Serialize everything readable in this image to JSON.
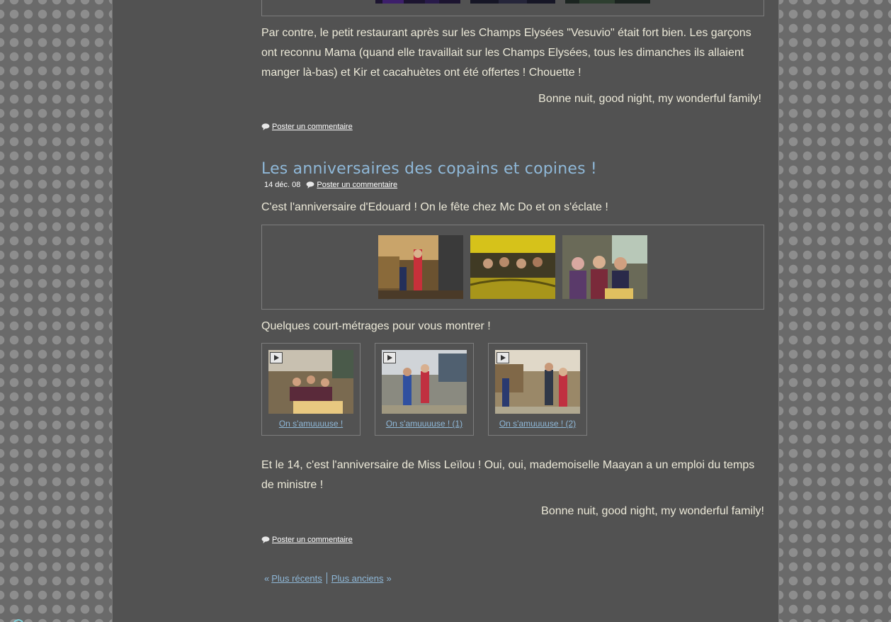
{
  "post_previous": {
    "paragraph": "Par contre, le petit restaurant après sur les Champs Elysées \"Vesuvio\" était fort bien. Les garçons ont reconnu Mama (quand elle travaillait sur les Champs Elysées, tous les dimanches ils allaient manger là-bas) et Kir et cacahuètes ont été offertes ! Chouette !",
    "signoff": "Bonne nuit, good night, my wonderful family!",
    "comment_link": "Poster un commentaire"
  },
  "post": {
    "title": "Les anniversaires des copains et copines !",
    "date": "14 déc. 08",
    "meta_comment_link": "Poster un commentaire",
    "intro": "C'est l'anniversaire d'Edouard ! On le fête chez Mc Do et on s'éclate !",
    "videos_intro": "Quelques court-métrages pour vous montrer !",
    "videos": [
      {
        "caption": "On s'amuuuuse !"
      },
      {
        "caption": "On s'amuuuuse ! (1)"
      },
      {
        "caption": "On s'amuuuuse ! (2)"
      }
    ],
    "paragraph": "Et le 14, c'est l'anniversaire de Miss Leïlou ! Oui, oui, mademoiselle Maayan a un emploi du temps de ministre !",
    "signoff": "Bonne nuit, good night, my wonderful family!",
    "comment_link": "Poster un commentaire"
  },
  "pager": {
    "left_quote": "«",
    "newer": "Plus récents",
    "older": "Plus anciens",
    "right_quote": "»"
  },
  "colors": {
    "page_bg": "#525252",
    "body_text": "#ece9d8",
    "link_blue": "#8fb8d8"
  }
}
